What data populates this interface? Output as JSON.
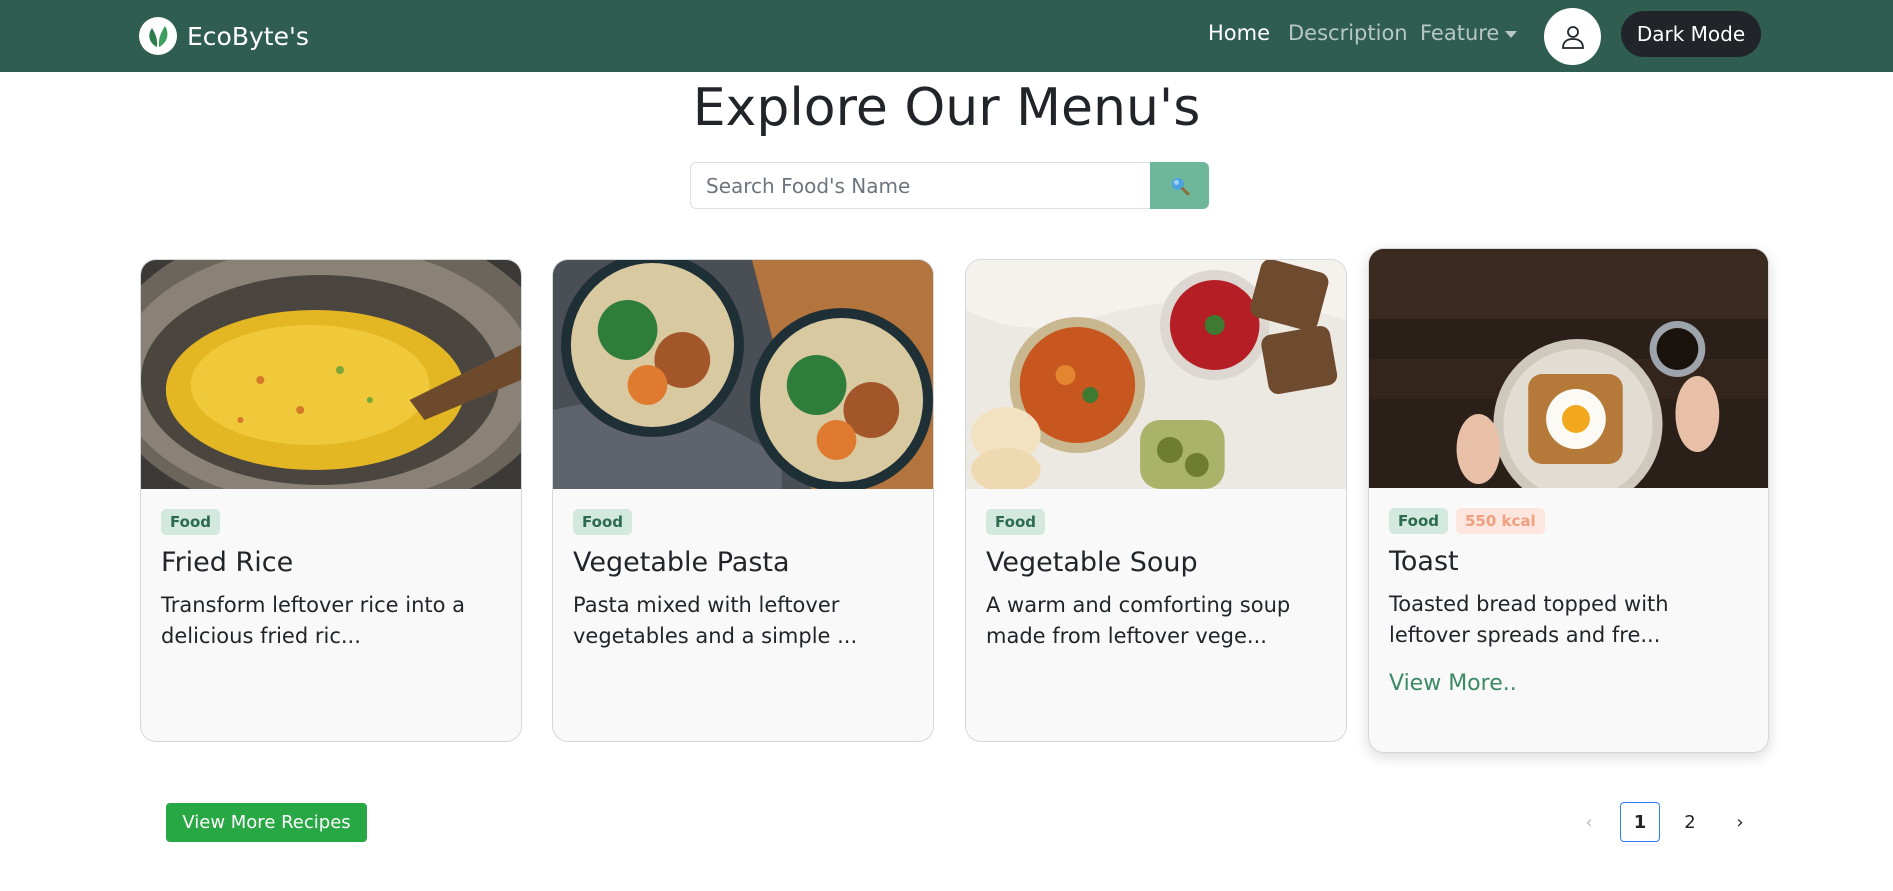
{
  "navbar": {
    "brand": "EcoByte's",
    "links": [
      {
        "label": "Home",
        "active": true
      },
      {
        "label": "Description",
        "active": false
      },
      {
        "label": "Feature",
        "active": false,
        "dropdown": true
      }
    ],
    "user_icon": "person-icon",
    "dark_mode_label": "Dark Mode"
  },
  "page_title": "Explore Our Menu's",
  "search": {
    "placeholder": "Search Food's Name",
    "value": "",
    "icon": "search-icon"
  },
  "cards": [
    {
      "badge": "Food",
      "title": "Fried Rice",
      "description": "Transform leftover rice into a delicious fried ric...",
      "image": "fried-rice-photo"
    },
    {
      "badge": "Food",
      "title": "Vegetable Pasta",
      "description": "Pasta mixed with leftover vegetables and a simple ...",
      "image": "vegetable-pasta-photo"
    },
    {
      "badge": "Food",
      "title": "Vegetable Soup",
      "description": "A warm and comforting soup made from leftover vege...",
      "image": "vegetable-soup-photo"
    },
    {
      "badge": "Food",
      "kcal": "550 kcal",
      "title": "Toast",
      "description": "Toasted bread topped with leftover spreads and fre...",
      "link": "View More..",
      "image": "toast-photo"
    }
  ],
  "view_more_button": "View More Recipes",
  "pagination": {
    "prev": "‹",
    "pages": [
      "1",
      "2"
    ],
    "current": "1",
    "next": "›"
  },
  "colors": {
    "navbar": "#2f5d50",
    "search_button": "#6fb79a",
    "primary_green": "#28a745",
    "dark_button": "#212529"
  }
}
